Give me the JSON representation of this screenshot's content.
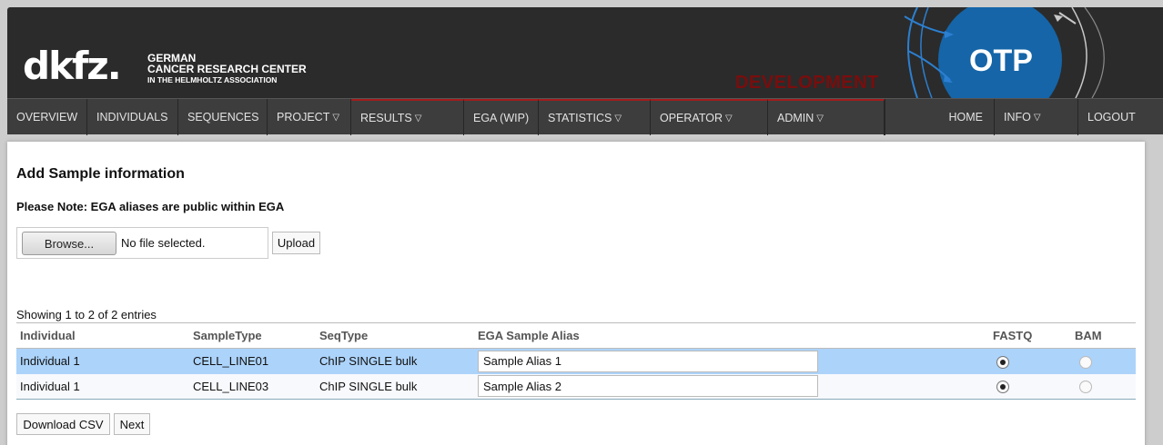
{
  "header": {
    "logo_mark": "dkfz.",
    "logo_line1": "GERMAN",
    "logo_line2": "CANCER RESEARCH CENTER",
    "logo_line3": "IN THE HELMHOLTZ ASSOCIATION",
    "environment": "DEVELOPMENT",
    "app_name": "OTP",
    "colors": {
      "header_bg": "#2b2b2b",
      "otp_circle": "#1565a8",
      "dev_text": "#7a0d0d"
    }
  },
  "nav": {
    "overview": "OVERVIEW",
    "individuals": "INDIVIDUALS",
    "sequences": "SEQUENCES",
    "project": "PROJECT",
    "results": "RESULTS",
    "ega": "EGA (WIP)",
    "statistics": "STATISTICS",
    "operator": "OPERATOR",
    "admin": "ADMIN",
    "home": "HOME",
    "info": "INFO",
    "logout": "LOGOUT",
    "caret": "▽"
  },
  "page": {
    "title": "Add Sample information",
    "note": "Please Note: EGA aliases are public within EGA",
    "browse_label": "Browse...",
    "file_status": "No file selected.",
    "upload_label": "Upload",
    "showing": "Showing 1 to 2 of 2 entries"
  },
  "table": {
    "headers": [
      "Individual",
      "SampleType",
      "SeqType",
      "EGA Sample Alias",
      "FASTQ",
      "BAM"
    ],
    "rows": [
      {
        "individual": "Individual 1",
        "sample_type": "CELL_LINE01",
        "seq_type": "ChIP SINGLE bulk",
        "alias": "Sample Alias 1",
        "fastq_selected": true,
        "bam_selected": false
      },
      {
        "individual": "Individual 1",
        "sample_type": "CELL_LINE03",
        "seq_type": "ChIP SINGLE bulk",
        "alias": "Sample Alias 2",
        "fastq_selected": true,
        "bam_selected": false
      }
    ]
  },
  "actions": {
    "download_csv": "Download CSV",
    "next": "Next"
  }
}
